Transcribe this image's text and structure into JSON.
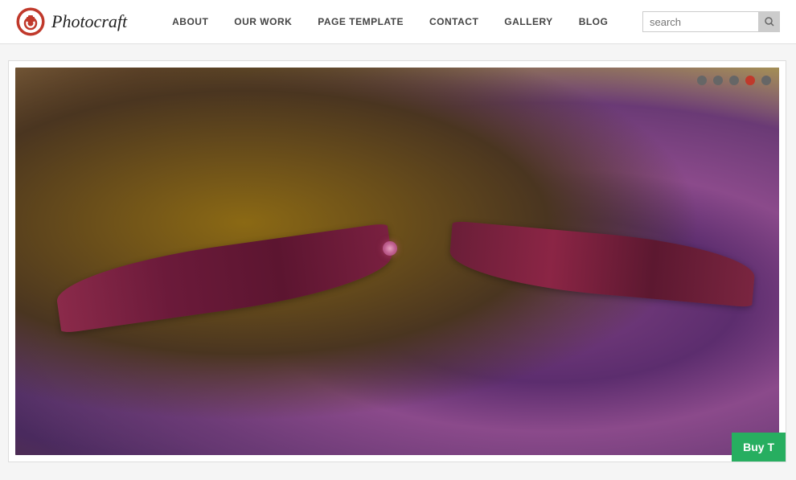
{
  "header": {
    "logo_text": "Photocraft",
    "nav": {
      "items": [
        {
          "label": "About",
          "id": "about"
        },
        {
          "label": "Our Work",
          "id": "our-work"
        },
        {
          "label": "Page Template",
          "id": "page-template"
        },
        {
          "label": "Contact",
          "id": "contact"
        },
        {
          "label": "Gallery",
          "id": "gallery"
        },
        {
          "label": "Blog",
          "id": "blog"
        }
      ]
    },
    "search": {
      "placeholder": "search",
      "icon": "search-icon"
    }
  },
  "slider": {
    "dots": [
      {
        "state": "inactive",
        "index": 0
      },
      {
        "state": "inactive",
        "index": 1
      },
      {
        "state": "inactive",
        "index": 2
      },
      {
        "state": "active",
        "index": 3
      },
      {
        "state": "inactive",
        "index": 4
      }
    ],
    "buy_button_label": "Buy T"
  }
}
